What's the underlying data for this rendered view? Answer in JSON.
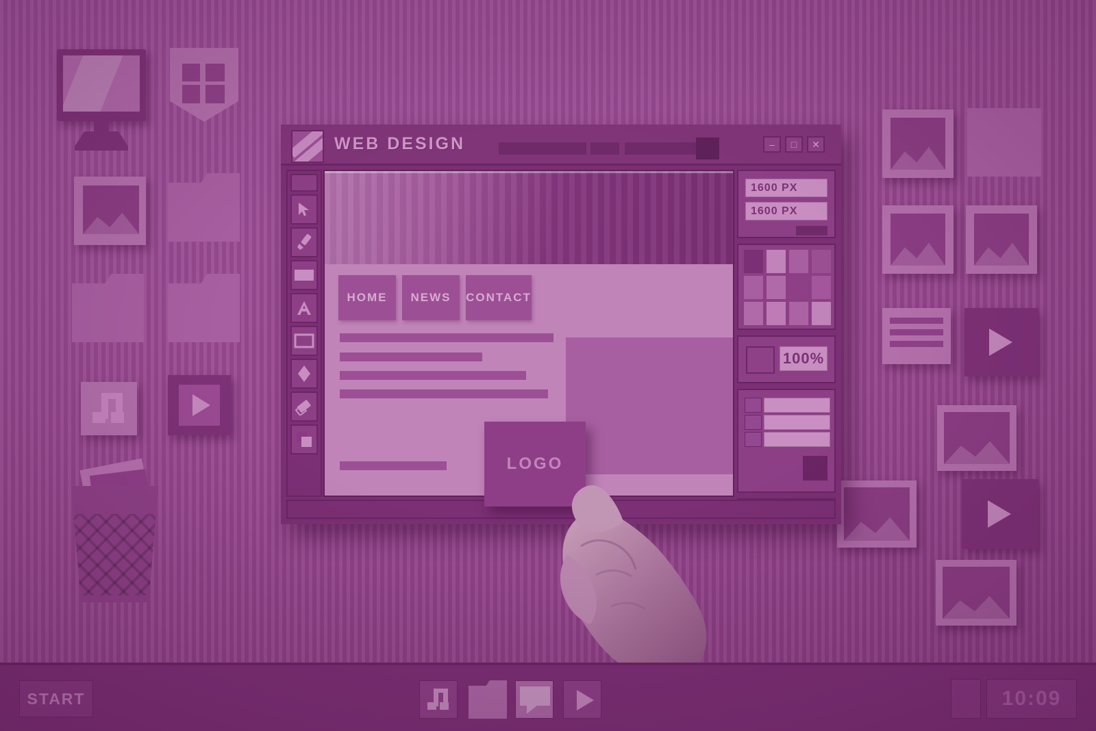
{
  "theme": {
    "background": "#9c4b94",
    "paper_light": "#b370ab",
    "paper_mid": "#a85fa1",
    "paper_dark": "#7b2f74",
    "accent_text": "#cf95c8",
    "field_bg": "#c88ec1"
  },
  "window": {
    "title": "WEB DESIGN",
    "logo_icon": "app-logo-icon",
    "controls": [
      {
        "name": "minimize",
        "glyph": "–"
      },
      {
        "name": "maximize",
        "glyph": "□"
      },
      {
        "name": "close",
        "glyph": "✕"
      }
    ]
  },
  "toolbar": {
    "tools": [
      {
        "name": "blank-tool",
        "icon": "blank-icon"
      },
      {
        "name": "select-tool",
        "icon": "cursor-arrow-icon"
      },
      {
        "name": "brush-tool",
        "icon": "paintbrush-icon"
      },
      {
        "name": "fill-rectangle-tool",
        "icon": "filled-rectangle-icon"
      },
      {
        "name": "text-tool",
        "icon": "text-a-icon",
        "glyph": "A"
      },
      {
        "name": "rectangle-tool",
        "icon": "outlined-rectangle-icon"
      },
      {
        "name": "shape-tool",
        "icon": "diamond-icon"
      },
      {
        "name": "eraser-tool",
        "icon": "eraser-icon"
      },
      {
        "name": "layers-tool",
        "icon": "stacked-squares-icon"
      }
    ]
  },
  "canvas": {
    "hero_label": "hero-banner",
    "nav": [
      {
        "label": "HOME"
      },
      {
        "label": "NEWS"
      },
      {
        "label": "CONTACT"
      }
    ],
    "content_lines": 5,
    "image_placeholder": "image-placeholder"
  },
  "sidebar": {
    "dimensions": {
      "width_field": "1600 PX",
      "height_field": "1600 PX"
    },
    "palette": {
      "rows": 3,
      "cols": 4,
      "colors": [
        "#7b2f74",
        "#c184ba",
        "#a85fa1",
        "#9a4f93",
        "#a85fa1",
        "#b06aa9",
        "#8e3f86",
        "#a3569c",
        "#b06aa9",
        "#bd7cb6",
        "#ab63a4",
        "#c184ba"
      ]
    },
    "zoom": {
      "value": "100%",
      "swatch": "current-color-swatch"
    },
    "layers": [
      {
        "name": "layer-row-1"
      },
      {
        "name": "layer-row-2"
      },
      {
        "name": "layer-row-3"
      }
    ]
  },
  "dragged_item": {
    "label": "LOGO"
  },
  "desktop_icons": {
    "left": [
      {
        "name": "monitor-icon",
        "type": "monitor"
      },
      {
        "name": "shield-window-icon",
        "type": "shield"
      },
      {
        "name": "photo-icon",
        "type": "photo"
      },
      {
        "name": "folder-icon-1",
        "type": "folder"
      },
      {
        "name": "folder-icon-2",
        "type": "folder"
      },
      {
        "name": "folder-icon-3",
        "type": "folder"
      },
      {
        "name": "music-icon",
        "type": "music"
      },
      {
        "name": "video-icon",
        "type": "video"
      },
      {
        "name": "trash-bin-icon",
        "type": "trash"
      }
    ],
    "right": [
      {
        "name": "photo-icon-r1",
        "type": "photo"
      },
      {
        "name": "photo-icon-r2",
        "type": "photo"
      },
      {
        "name": "photo-icon-r3",
        "type": "photo"
      },
      {
        "name": "photo-icon-r4",
        "type": "photo"
      },
      {
        "name": "folder-icon-r1",
        "type": "folder"
      },
      {
        "name": "document-icon",
        "type": "document"
      },
      {
        "name": "video-icon-r1",
        "type": "video"
      },
      {
        "name": "video-icon-r2",
        "type": "video"
      },
      {
        "name": "photo-icon-r5",
        "type": "photo"
      },
      {
        "name": "photo-icon-r6",
        "type": "photo"
      }
    ]
  },
  "taskbar": {
    "start_label": "START",
    "icons": [
      {
        "name": "taskbar-music-icon",
        "icon": "music-note-icon"
      },
      {
        "name": "taskbar-folder-icon",
        "icon": "folder-icon"
      },
      {
        "name": "taskbar-chat-icon",
        "icon": "chat-bubble-icon"
      },
      {
        "name": "taskbar-video-icon",
        "icon": "play-triangle-icon"
      }
    ],
    "clock": "10:09"
  }
}
